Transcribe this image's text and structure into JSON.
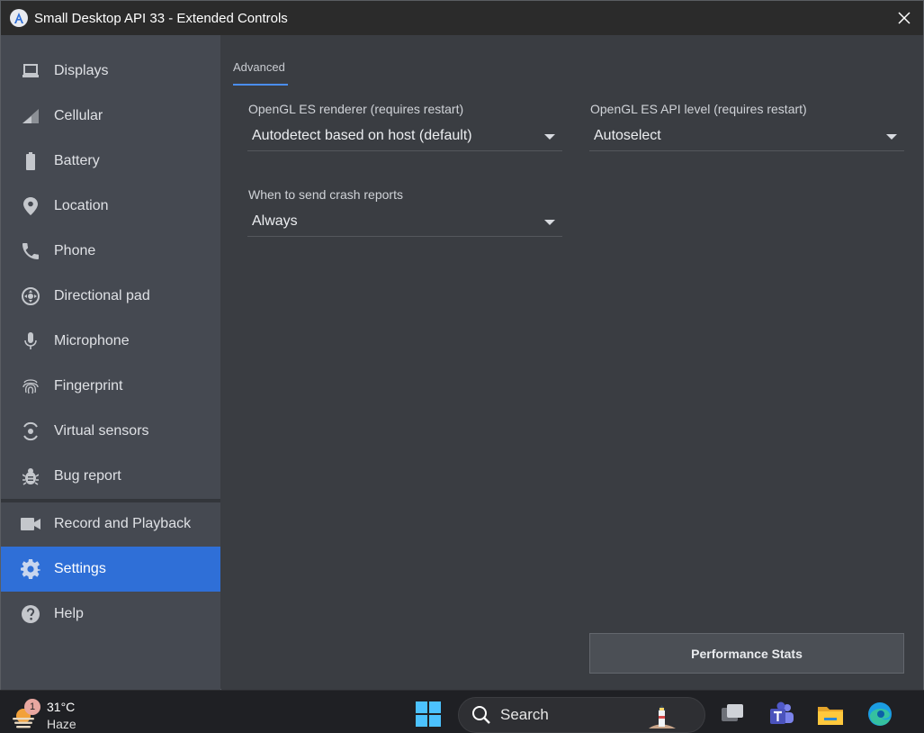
{
  "window": {
    "title": "Small Desktop API 33 - Extended Controls"
  },
  "sidebar": {
    "items": [
      {
        "label": "Displays",
        "icon": "display-icon"
      },
      {
        "label": "Cellular",
        "icon": "signal-icon"
      },
      {
        "label": "Battery",
        "icon": "battery-icon"
      },
      {
        "label": "Location",
        "icon": "location-pin-icon"
      },
      {
        "label": "Phone",
        "icon": "phone-icon"
      },
      {
        "label": "Directional pad",
        "icon": "dpad-icon"
      },
      {
        "label": "Microphone",
        "icon": "microphone-icon"
      },
      {
        "label": "Fingerprint",
        "icon": "fingerprint-icon"
      },
      {
        "label": "Virtual sensors",
        "icon": "rotate-sensor-icon"
      },
      {
        "label": "Bug report",
        "icon": "bug-icon"
      },
      {
        "label": "Record and Playback",
        "icon": "video-camera-icon"
      },
      {
        "label": "Settings",
        "icon": "gear-icon",
        "active": true
      },
      {
        "label": "Help",
        "icon": "help-icon"
      }
    ]
  },
  "main": {
    "tab": "Advanced",
    "renderer": {
      "label": "OpenGL ES renderer (requires restart)",
      "value": "Autodetect based on host (default)"
    },
    "api_level": {
      "label": "OpenGL ES API level (requires restart)",
      "value": "Autoselect"
    },
    "crash_reports": {
      "label": "When to send crash reports",
      "value": "Always"
    },
    "perf_button": "Performance Stats"
  },
  "taskbar": {
    "weather_badge": "1",
    "temperature": "31°C",
    "condition": "Haze",
    "search_label": "Search"
  },
  "colors": {
    "accent": "#2f6fd7",
    "sidebar_bg": "#454951",
    "main_bg": "#3a3d42",
    "titlebar_bg": "#2b2b2b"
  }
}
